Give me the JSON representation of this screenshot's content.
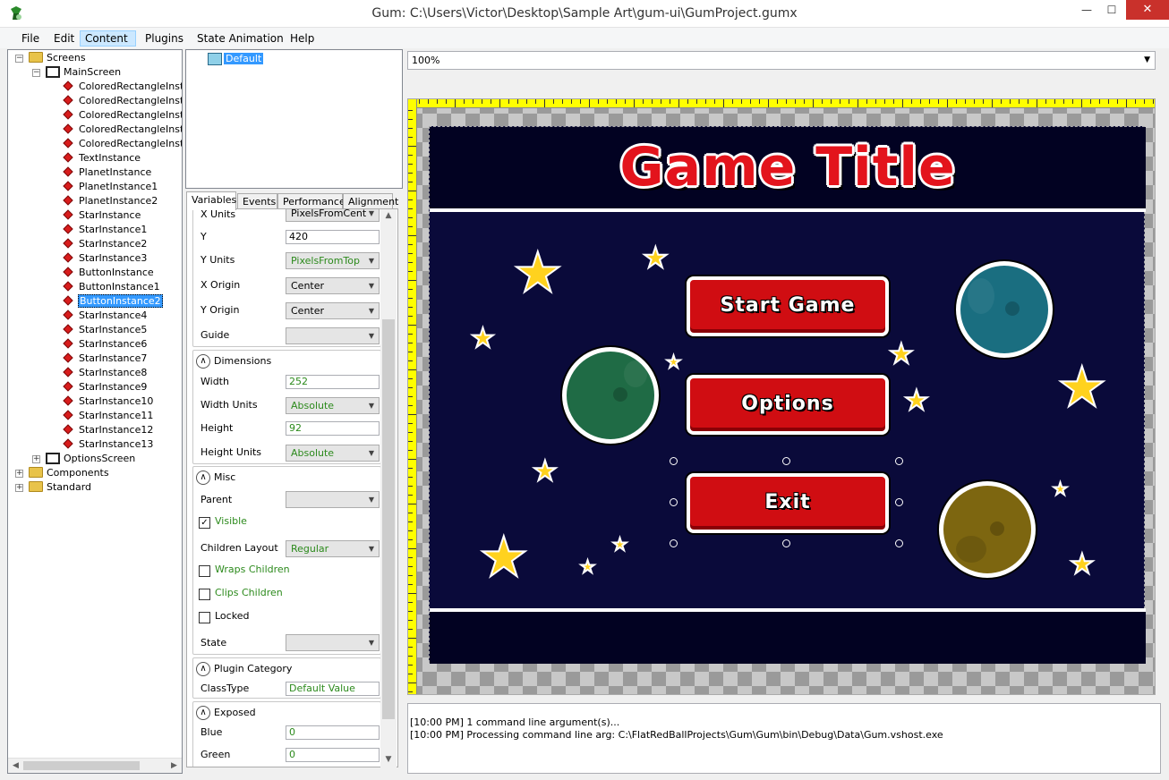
{
  "window": {
    "title": "Gum: C:\\Users\\Victor\\Desktop\\Sample Art\\gum-ui\\GumProject.gumx",
    "minimize": "—",
    "maximize": "☐",
    "close": "✕"
  },
  "menu": [
    "File",
    "Edit",
    "Content",
    "Plugins",
    "State Animation",
    "Help"
  ],
  "tree": {
    "screens": "Screens",
    "main_screen": "MainScreen",
    "instances": [
      "ColoredRectangleInstar",
      "ColoredRectangleInstar",
      "ColoredRectangleInstar",
      "ColoredRectangleInstar",
      "ColoredRectangleInstar",
      "TextInstance",
      "PlanetInstance",
      "PlanetInstance1",
      "PlanetInstance2",
      "StarInstance",
      "StarInstance1",
      "StarInstance2",
      "StarInstance3",
      "ButtonInstance",
      "ButtonInstance1",
      "ButtonInstance2",
      "StarInstance4",
      "StarInstance5",
      "StarInstance6",
      "StarInstance7",
      "StarInstance8",
      "StarInstance9",
      "StarInstance10",
      "StarInstance11",
      "StarInstance12",
      "StarInstance13"
    ],
    "selected_index": 15,
    "options_screen": "OptionsScreen",
    "components": "Components",
    "standard": "Standard"
  },
  "states": {
    "default": "Default"
  },
  "tabs": [
    "Variables",
    "Events",
    "Performance",
    "Alignment"
  ],
  "properties": {
    "x_units_label": "X Units",
    "x_units_value": "PixelsFromCent",
    "y_label": "Y",
    "y_value": "420",
    "y_units_label": "Y Units",
    "y_units_value": "PixelsFromTop",
    "x_origin_label": "X Origin",
    "x_origin_value": "Center",
    "y_origin_label": "Y Origin",
    "y_origin_value": "Center",
    "guide_label": "Guide",
    "guide_value": "",
    "dimensions_header": "Dimensions",
    "width_label": "Width",
    "width_value": "252",
    "width_units_label": "Width Units",
    "width_units_value": "Absolute",
    "height_label": "Height",
    "height_value": "92",
    "height_units_label": "Height Units",
    "height_units_value": "Absolute",
    "misc_header": "Misc",
    "parent_label": "Parent",
    "parent_value": "",
    "visible_label": "Visible",
    "visible_checked": "✓",
    "children_layout_label": "Children Layout",
    "children_layout_value": "Regular",
    "wraps_children_label": "Wraps Children",
    "clips_children_label": "Clips Children",
    "locked_label": "Locked",
    "state_label": "State",
    "state_value": "",
    "plugin_category_header": "Plugin Category",
    "classtype_label": "ClassType",
    "classtype_value": "Default Value",
    "exposed_header": "Exposed",
    "blue_label": "Blue",
    "blue_value": "0",
    "green_label": "Green",
    "green_value": "0"
  },
  "zoom": {
    "value": "100%"
  },
  "game": {
    "title": "Game Title",
    "start_button": "Start Game",
    "options_button": "Options",
    "exit_button": "Exit",
    "colors": {
      "background": "#0a0a3a",
      "button": "#d00d12",
      "planet_teal": "#1a6e80",
      "planet_green": "#1f6b45",
      "planet_olive": "#7d6610",
      "star": "#ffd21e"
    }
  },
  "log": [
    "[10:00 PM] 1 command line argument(s)...",
    "[10:00 PM] Processing command line arg: C:\\FlatRedBallProjects\\Gum\\Gum\\bin\\Debug\\Data\\Gum.vshost.exe"
  ]
}
